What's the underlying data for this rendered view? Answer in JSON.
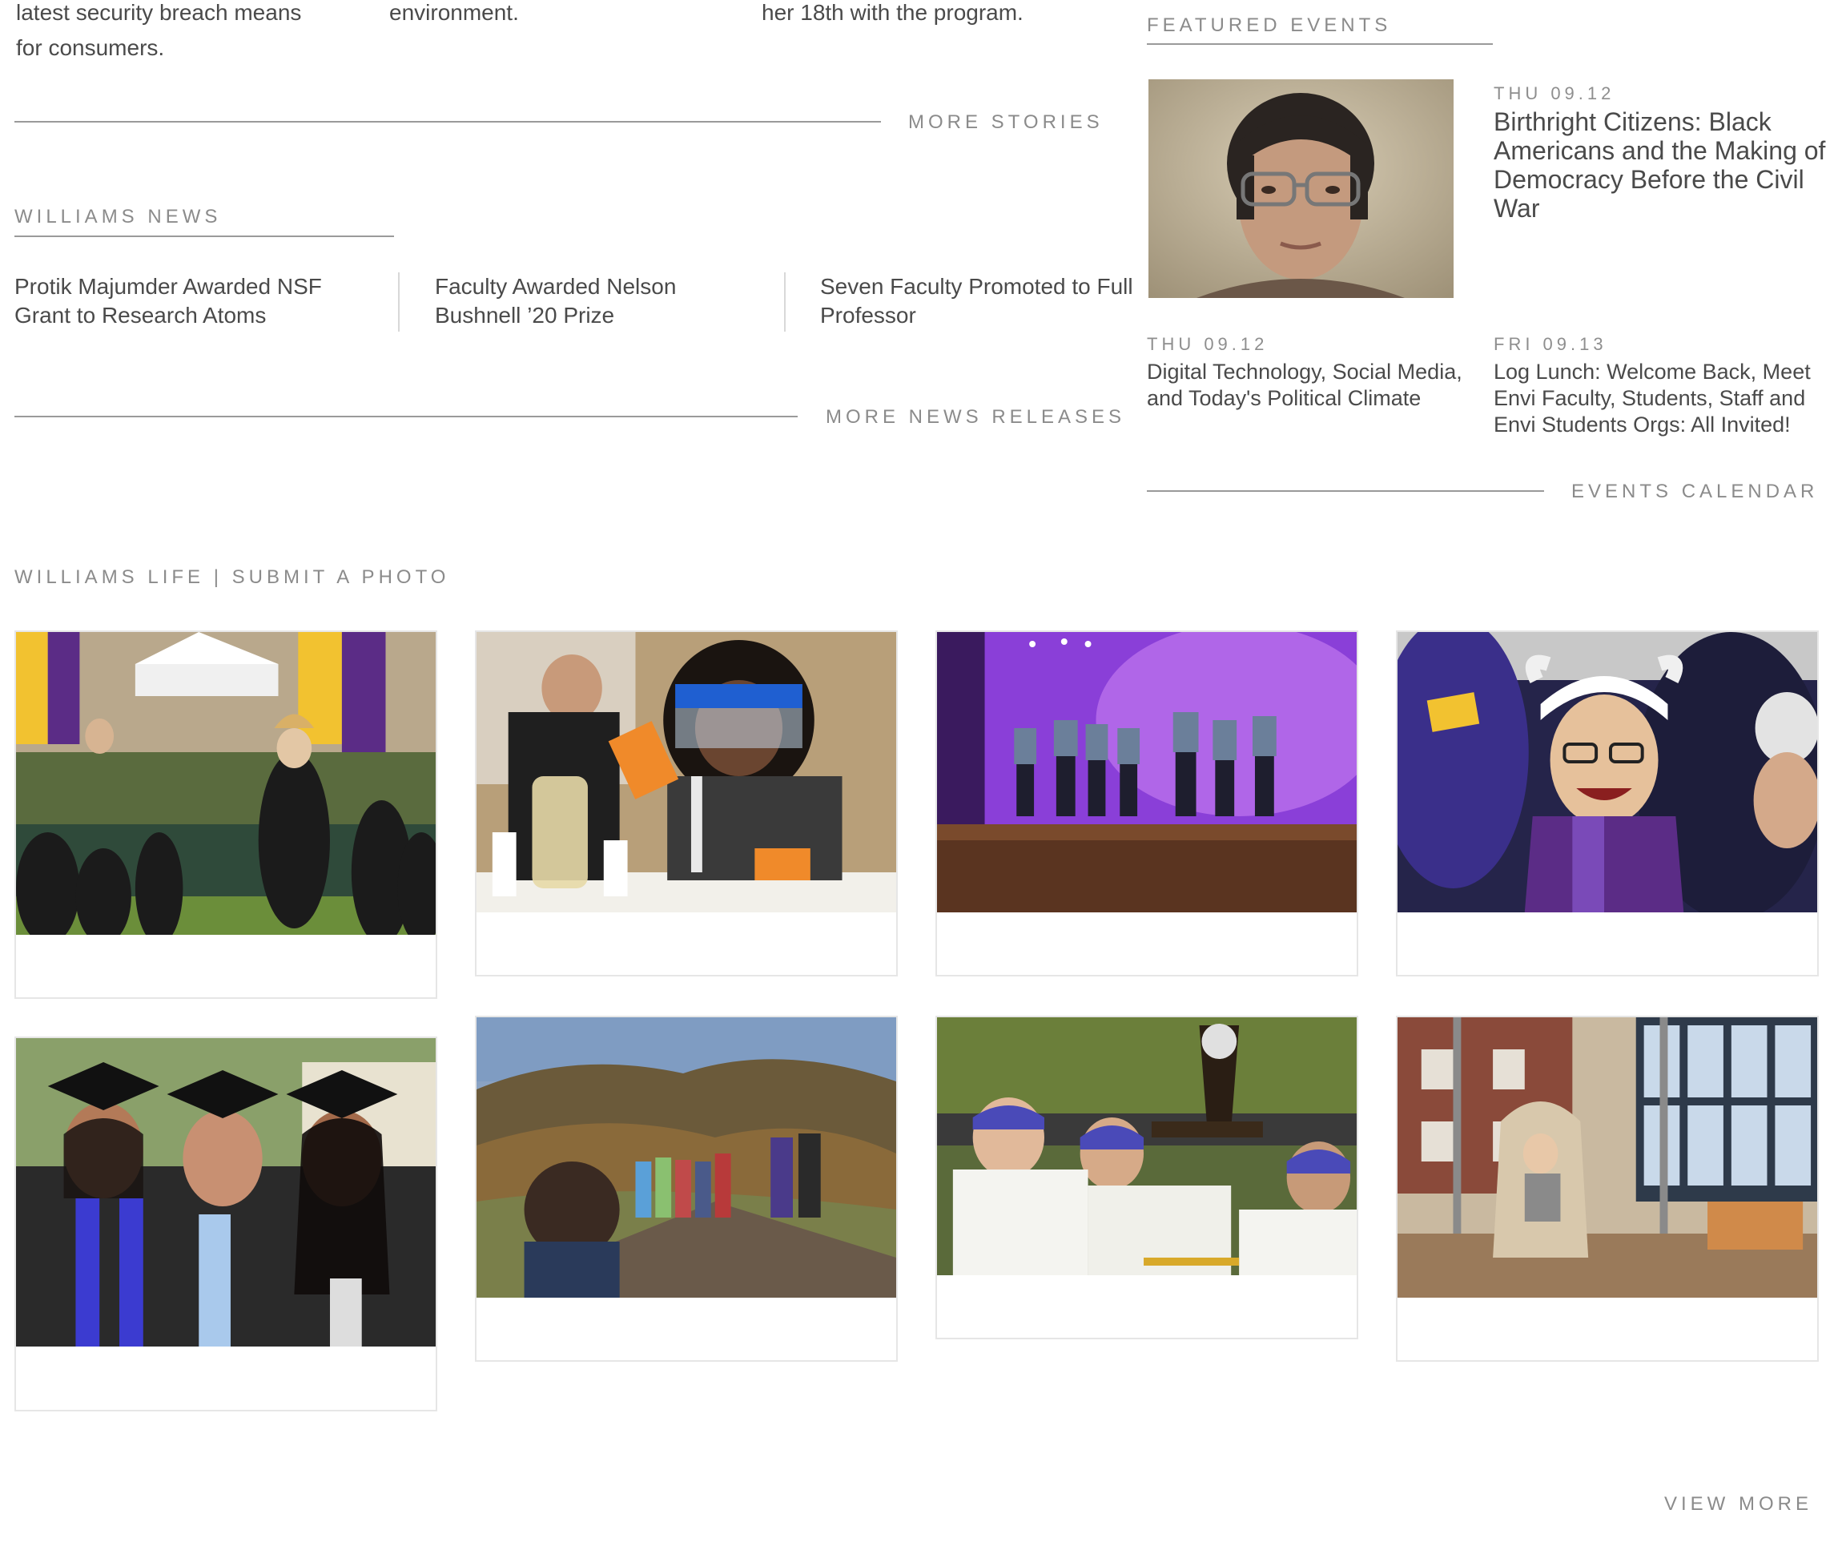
{
  "stories": {
    "snippets": [
      {
        "lines": [
          "latest security breach means",
          "for consumers."
        ]
      },
      {
        "lines": [
          "environment."
        ]
      },
      {
        "lines": [
          "her 18th with the program."
        ]
      }
    ],
    "more_label": "MORE STORIES"
  },
  "news": {
    "heading": "WILLIAMS NEWS",
    "items": [
      {
        "title_line1": "Protik Majumder Awarded NSF",
        "title_line2": "Grant to Research Atoms"
      },
      {
        "title_line1": "Faculty Awarded Nelson",
        "title_line2": "Bushnell ’20 Prize"
      },
      {
        "title_line1": "Seven Faculty Promoted to Full",
        "title_line2": "Professor"
      }
    ],
    "more_label": "MORE NEWS RELEASES"
  },
  "events": {
    "heading": "FEATURED EVENTS",
    "featured": {
      "date": "THU 09.12",
      "title_lines": [
        "Birthright Citizens: Black",
        "Americans and the Making of",
        "Democracy Before the Civil",
        "War"
      ]
    },
    "items": [
      {
        "date": "THU 09.12",
        "title_lines": [
          "Digital Technology, Social Media,",
          "and Today's Political Climate"
        ]
      },
      {
        "date": "FRI 09.13",
        "title_lines": [
          "Log Lunch: Welcome Back, Meet",
          "Envi Faculty, Students, Staff and",
          "Envi Students Orgs: All Invited!"
        ]
      }
    ],
    "calendar_label": "EVENTS CALENDAR"
  },
  "life": {
    "heading": "WILLIAMS LIFE",
    "separator": "|",
    "submit_label": "SUBMIT A PHOTO",
    "photos": [
      {
        "subject": "commencement-procession"
      },
      {
        "subject": "lab-science-student"
      },
      {
        "subject": "dance-performance-stage"
      },
      {
        "subject": "cheering-fans"
      },
      {
        "subject": "graduates-portrait"
      },
      {
        "subject": "mountain-hike"
      },
      {
        "subject": "softball-trophy-celebration"
      },
      {
        "subject": "student-lounge-reading"
      }
    ],
    "view_more_label": "VIEW MORE"
  },
  "colors": {
    "text": "#4a4a4a",
    "muted": "#8b8b8b",
    "rule": "#9a9a9a",
    "purple": "#5b2c86",
    "gold": "#f2c230"
  }
}
